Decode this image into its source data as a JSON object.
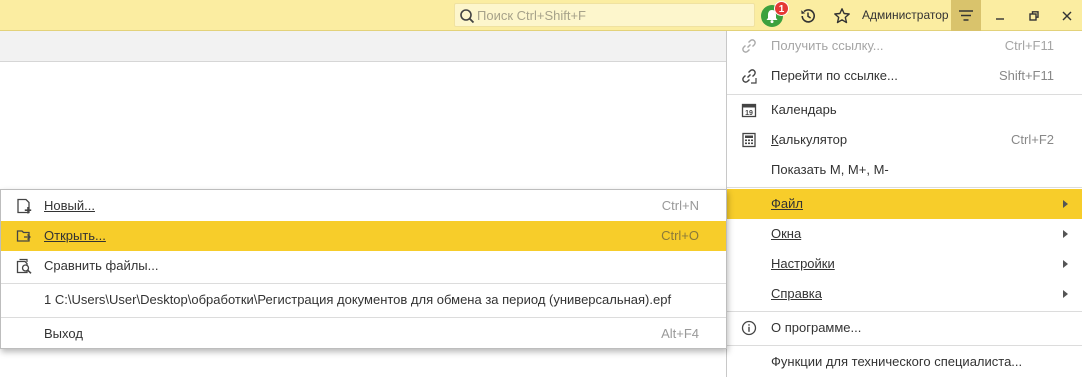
{
  "topbar": {
    "search_placeholder": "Поиск Ctrl+Shift+F",
    "notification_count": "1",
    "user_name": "Администратор"
  },
  "main_menu": {
    "items": [
      {
        "label": "Получить ссылку...",
        "shortcut": "Ctrl+F11",
        "icon": "link-icon",
        "disabled": true
      },
      {
        "label": "Перейти по ссылке...",
        "shortcut": "Shift+F11",
        "icon": "goto-link-icon"
      },
      {
        "label": "Календарь",
        "shortcut": "",
        "icon": "calendar-icon"
      },
      {
        "label": "Калькулятор",
        "shortcut": "Ctrl+F2",
        "icon": "calculator-icon"
      },
      {
        "label": "Показать M, M+, M-",
        "shortcut": ""
      },
      {
        "label": "Файл",
        "submenu": true,
        "active": true
      },
      {
        "label": "Окна",
        "submenu": true
      },
      {
        "label": "Настройки",
        "submenu": true
      },
      {
        "label": "Справка",
        "submenu": true
      },
      {
        "label": "О программе...",
        "icon": "info-icon"
      },
      {
        "label": "Функции для технического специалиста..."
      }
    ]
  },
  "file_menu": {
    "items": [
      {
        "label": "Новый...",
        "shortcut": "Ctrl+N",
        "icon": "new-file-icon"
      },
      {
        "label": "Открыть...",
        "shortcut": "Ctrl+O",
        "icon": "open-folder-icon",
        "active": true
      },
      {
        "label": "Сравнить файлы...",
        "shortcut": "",
        "icon": "compare-files-icon"
      },
      {
        "label": "1 C:\\Users\\User\\Desktop\\обработки\\Регистрация документов для обмена за период (универсальная).epf",
        "shortcut": ""
      },
      {
        "label": "Выход",
        "shortcut": "Alt+F4"
      }
    ]
  },
  "colors": {
    "topbar_bg": "#fbeda1",
    "highlight": "#f7cd2a",
    "notification_green": "#3ca13e",
    "badge_red": "#e53935"
  }
}
